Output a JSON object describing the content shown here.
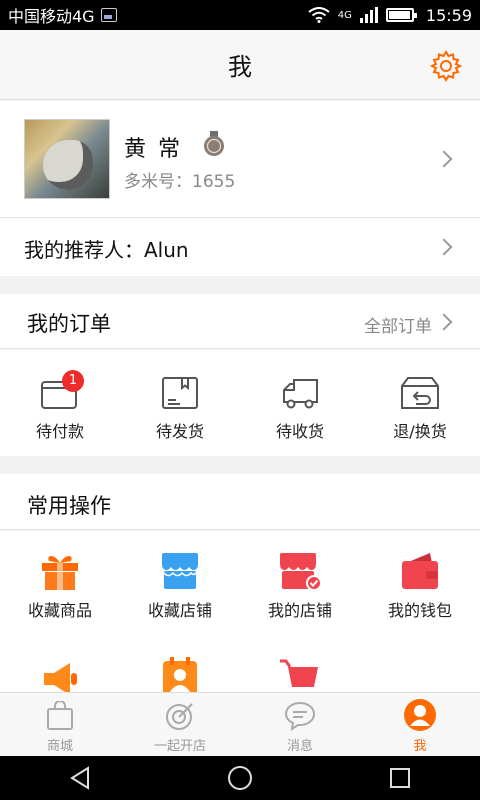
{
  "status_bar": {
    "carrier": "中国移动4G",
    "network": "4G",
    "time": "15:59"
  },
  "header": {
    "title": "我",
    "settings_icon": "gear-icon"
  },
  "profile": {
    "name": "黄常",
    "member_id": "多米号：1655"
  },
  "referrer": {
    "label": "我的推荐人：Alun"
  },
  "orders": {
    "title": "我的订单",
    "all_link": "全部订单",
    "items": [
      {
        "label": "待付款",
        "icon": "wallet-icon",
        "badge": "1"
      },
      {
        "label": "待发货",
        "icon": "box-icon"
      },
      {
        "label": "待收货",
        "icon": "truck-icon"
      },
      {
        "label": "退/换货",
        "icon": "return-icon"
      }
    ]
  },
  "common": {
    "title": "常用操作",
    "items": [
      {
        "label": "收藏商品",
        "icon": "gift-icon"
      },
      {
        "label": "收藏店铺",
        "icon": "store-icon"
      },
      {
        "label": "我的店铺",
        "icon": "my-store-icon"
      },
      {
        "label": "我的钱包",
        "icon": "purse-icon"
      }
    ],
    "more_icons": [
      "megaphone-icon",
      "contact-card-icon",
      "cart-icon"
    ]
  },
  "tabs": [
    {
      "label": "商城",
      "icon": "bag-icon"
    },
    {
      "label": "一起开店",
      "icon": "target-icon"
    },
    {
      "label": "消息",
      "icon": "chat-icon"
    },
    {
      "label": "我",
      "icon": "person-icon",
      "active": true
    }
  ],
  "colors": {
    "accent": "#ff6a00",
    "badge": "#ef2c2c",
    "blue": "#3aa0f0",
    "red": "#f0454f"
  }
}
